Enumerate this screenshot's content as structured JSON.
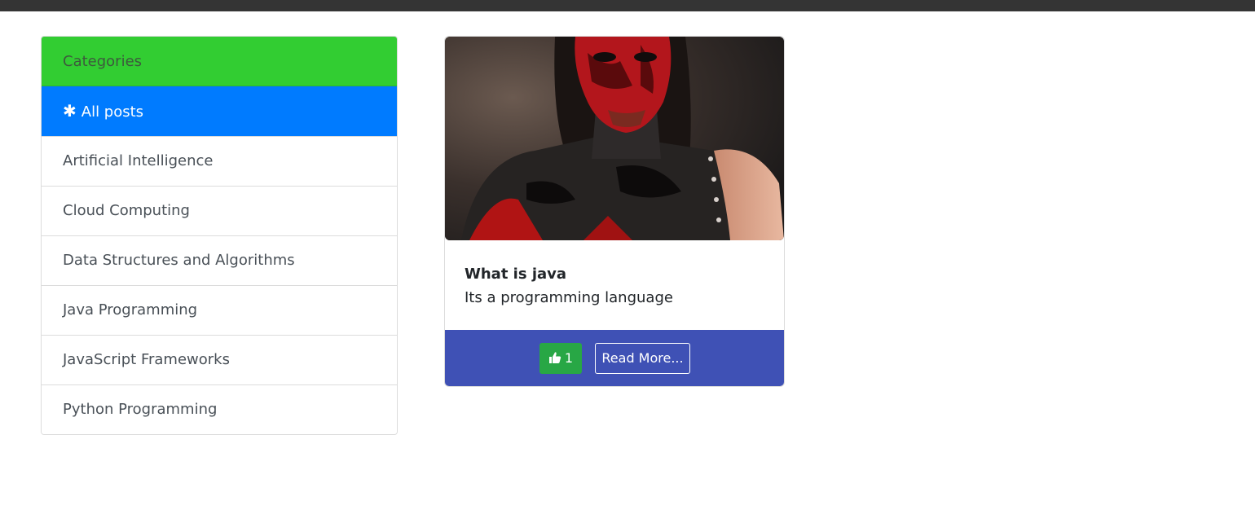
{
  "sidebar": {
    "header": "Categories",
    "all_posts": {
      "icon": "asterisk-icon",
      "glyph": "✱",
      "label": "All posts"
    },
    "items": [
      {
        "label": "Artificial Intelligence"
      },
      {
        "label": "Cloud Computing"
      },
      {
        "label": "Data Structures and Algorithms"
      },
      {
        "label": "Java Programming"
      },
      {
        "label": "JavaScript Frameworks"
      },
      {
        "label": "Python Programming"
      }
    ]
  },
  "post": {
    "title": "What is java",
    "description": "Its a programming language",
    "likes": "1",
    "like_icon": "thumbs-up-icon",
    "read_more": "Read More..."
  },
  "colors": {
    "header_green": "#32cd32",
    "active_blue": "#007bff",
    "footer_indigo": "#3f51b5",
    "like_green": "#28a745"
  }
}
